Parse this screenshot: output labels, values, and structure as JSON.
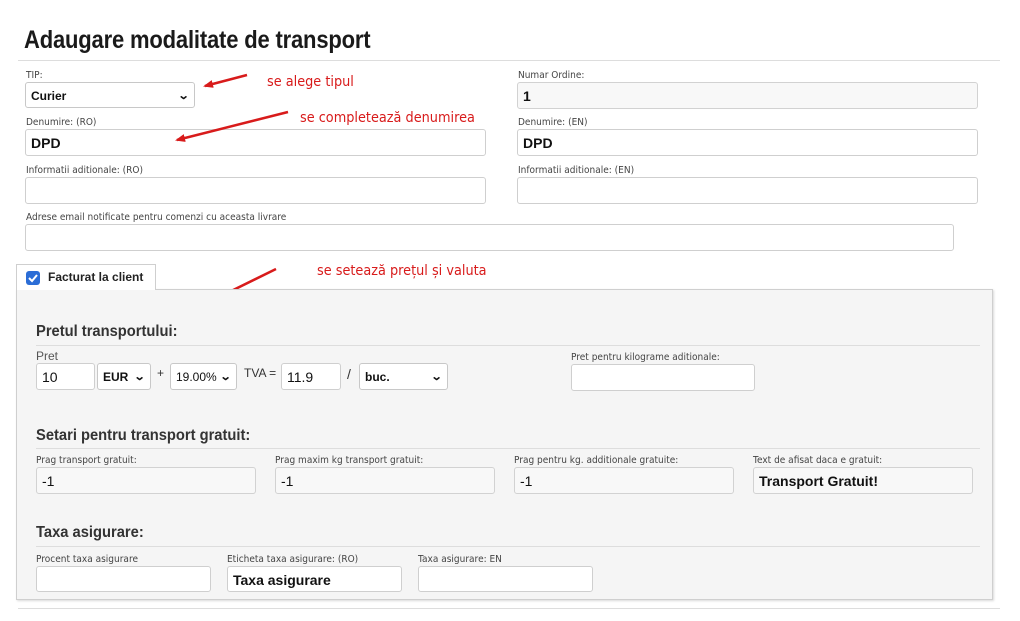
{
  "page": {
    "title": "Adaugare modalitate de transport"
  },
  "form": {
    "tip": {
      "label": "TIP:",
      "value": "Curier"
    },
    "numar_ordine": {
      "label": "Numar Ordine:",
      "value": "1"
    },
    "denumire_ro": {
      "label": "Denumire: (RO)",
      "value": "DPD"
    },
    "denumire_en": {
      "label": "Denumire: (EN)",
      "value": "DPD"
    },
    "info_ro": {
      "label": "Informatii aditionale: (RO)",
      "value": ""
    },
    "info_en": {
      "label": "Informatii aditionale: (EN)",
      "value": ""
    },
    "emails": {
      "label": "Adrese email notificate pentru comenzi cu aceasta livrare",
      "value": ""
    }
  },
  "annotations": {
    "tip": "se alege tipul",
    "denumire": "se completează denumirea",
    "pret": "se setează prețul și valuta",
    "color": "#d81b1b"
  },
  "billing_tab": {
    "label": "Facturat la client",
    "checked": true,
    "check_color": "#2b6dd6"
  },
  "transport_price": {
    "heading": "Pretul transportului:",
    "pret_label": "Pret",
    "pret_value": "10",
    "currency": "EUR",
    "plus": "+",
    "vat_rate": "19.00%",
    "tva_label": "TVA =",
    "tva_value": "11.9",
    "slash": "/",
    "unit": "buc.",
    "extra_kg_label": "Pret pentru kilograme aditionale:",
    "extra_kg_value": ""
  },
  "free_shipping": {
    "heading": "Setari pentru transport gratuit:",
    "prag_label": "Prag transport gratuit:",
    "prag_value": "-1",
    "prag_kg_label": "Prag maxim kg transport gratuit:",
    "prag_kg_value": "-1",
    "prag_extra_label": "Prag pentru kg. additionale gratuite:",
    "prag_extra_value": "-1",
    "text_label": "Text de afisat daca e gratuit:",
    "text_value": "Transport Gratuit!"
  },
  "insurance": {
    "heading": "Taxa asigurare:",
    "procent_label": "Procent taxa asigurare",
    "procent_value": "",
    "eticheta_label": "Eticheta taxa asigurare: (RO)",
    "eticheta_value": "Taxa asigurare",
    "en_label": "Taxa asigurare: EN",
    "en_value": ""
  }
}
